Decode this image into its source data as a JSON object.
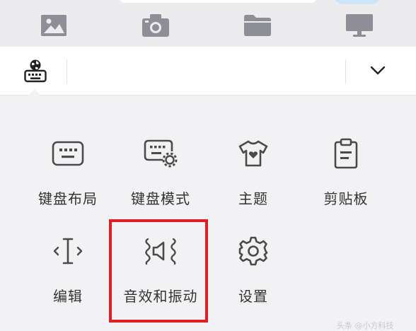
{
  "colors": {
    "icon": "#8e8e96",
    "icon_dark": "#4a4a4a",
    "highlight": "#e02020",
    "background": "#f2f2f4"
  },
  "top_icons": [
    "image-icon",
    "camera-icon",
    "folder-icon",
    "monitor-icon"
  ],
  "toolbar": {
    "keyboard_icon": "globe-keyboard-icon",
    "dropdown_icon": "chevron-down-icon"
  },
  "menu": {
    "row1": [
      {
        "label": "键盘布局",
        "icon": "keyboard-layout-icon"
      },
      {
        "label": "键盘模式",
        "icon": "keyboard-mode-icon"
      },
      {
        "label": "主题",
        "icon": "tshirt-heart-icon"
      },
      {
        "label": "剪贴板",
        "icon": "clipboard-icon"
      }
    ],
    "row2": [
      {
        "label": "编辑",
        "icon": "text-cursor-icon"
      },
      {
        "label": "音效和振动",
        "icon": "sound-vibration-icon",
        "highlighted": true
      },
      {
        "label": "设置",
        "icon": "gear-icon"
      }
    ]
  },
  "watermark": "头条 @小方科技"
}
